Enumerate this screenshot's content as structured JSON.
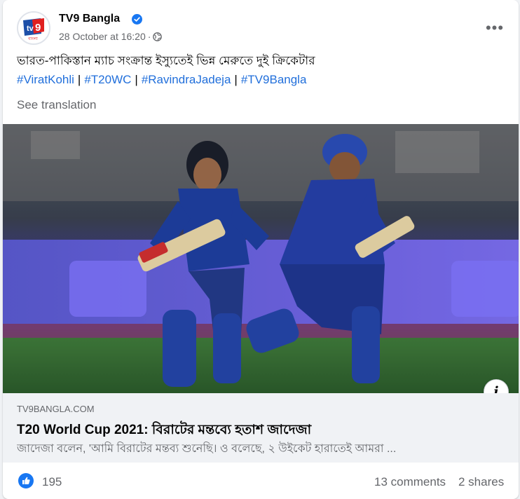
{
  "post": {
    "page_name": "TV9 Bangla",
    "timestamp": "28 October at 16:20",
    "dot": "·",
    "audience_icon": "globe-icon",
    "more_label": "•••",
    "caption": "ভারত-পাকিস্তান ম্যাচ সংক্রান্ত ইস্যুতেই ভিন্ন মেরুতে দুই ক্রিকেটার",
    "hashtags": [
      "#ViratKohli",
      "#T20WC",
      "#RavindraJadeja",
      "#TV9Bangla"
    ],
    "hashtag_separator": "|",
    "see_translation": "See translation",
    "avatar_text": "বাংলা"
  },
  "link_preview": {
    "domain": "TV9BANGLA.COM",
    "title": "T20 World Cup 2021: বিরাটের মন্তব্যে হতাশ জাদেজা",
    "description": "জাদেজা বলেন, 'আমি বিরাটের মন্তব্য শুনেছি। ও বলেছে, ২ উইকেট হারাতেই আমরা ...",
    "info_label": "i"
  },
  "footer": {
    "reaction_count": "195",
    "comments": "13 comments",
    "shares": "2 shares"
  },
  "colors": {
    "link": "#216fdb",
    "secondary_text": "#65676b",
    "verified": "#1877f2",
    "like": "#1877f2",
    "brand_red": "#e02020"
  }
}
